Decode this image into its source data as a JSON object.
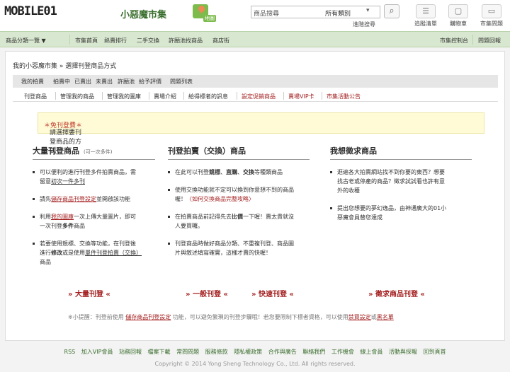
{
  "header": {
    "logo_text": "MOBILE01",
    "brand": "小惡魔市集",
    "map_badge": "地圖",
    "search": {
      "placeholder": "商品搜尋",
      "category": "所有類別",
      "advanced": "進階搜尋"
    },
    "tools": [
      {
        "label": "追蹤清單",
        "icon": "list-icon"
      },
      {
        "label": "購物車",
        "icon": "cart-icon"
      },
      {
        "label": "市集問題",
        "icon": "help-icon"
      }
    ]
  },
  "nav": {
    "items": [
      "商品分類一覽 ▼",
      "市集首頁",
      "熱賣排行",
      "二手交換",
      "許願池找商品",
      "商店街"
    ],
    "right": [
      "市集控制台",
      "問題回報"
    ]
  },
  "breadcrumb": "我的小惡魔市集 » 選擇刊登商品方式",
  "tabs": [
    "我的拍賣",
    "拍賣中",
    "已賣出",
    "未賣出",
    "許願池",
    "給予評價",
    "問題列表"
  ],
  "subtabs": [
    "刊登商品",
    "管理我的商品",
    "管理我的圖庫",
    "賣場介紹",
    "給得標者的訊息",
    "設定促銷商品",
    "賣場VIP卡",
    "市集活動公告"
  ],
  "notice": {
    "text": "請選擇要刊登商品的方式",
    "highlight": "＊免刊登費＊"
  },
  "col1": {
    "title": "大量刊登商品",
    "note": "(可一次多件)",
    "b1": "可以便利的進行刊登多件拍賣商品，需",
    "b1b": "留意",
    "b1u": "初次一件多刊",
    "b2a": "請先",
    "b2r": "儲存商品刊登設定",
    "b2b": "並開啟該功能",
    "b3a": "利用",
    "b3r": "我的圖庫",
    "b3b": "一次上傳大量圖片，即可",
    "b3c": "一次刊登",
    "b3d": "多件",
    "b3e": "商品",
    "b4a": "若要使用競標、交換等功能，在刊登後",
    "b4b": "進行",
    "b4c": "修改",
    "b4d": "或是使用",
    "b4u": "單件刊登拍賣（交換）",
    "b4e": "商品",
    "action": "» 大量刊登 «"
  },
  "col2": {
    "title": "刊登拍賣（交換）商品",
    "b1a": "在此可以刊登",
    "b1b": "競標",
    "b1c": "、",
    "b1d": "直購",
    "b1e": "、",
    "b1f": "交換",
    "b1g": "等種類商品",
    "b2a": "使用交換功能就不定可以換到你意想不到的商品",
    "b2b": "喔！",
    "b2r": "〈如何交換商品完整攻略〉",
    "b3a": "在拍賣商品前記得先去",
    "b3b": "比價",
    "b3c": "一下喔！賣太貴就沒",
    "b3d": "人要買囉。",
    "b4a": "刊登商品時做好商品分類、不重複刊登、商品圖",
    "b4b": "片與敘述填寫確實，這樣才賣的快喔！",
    "action1": "» 一般刊登 «",
    "action2": "» 快速刊登 «"
  },
  "col3": {
    "title": "我想徵求商品",
    "b1a": "逛遍各大拍賣網站找不到你要的東西？想要",
    "b1b": "找古老或停產的商品？徵求試試看也許有意",
    "b1c": "外的收穫",
    "b2a": "提出您想要的夢幻逸品，由神通廣大的01小",
    "b2b": "惡魔會員替您達成",
    "action": "» 徵求商品刊登 «"
  },
  "tip": {
    "a": "※小提醒：刊登前使用",
    "b": "儲存商品刊登設定",
    "c": "功能，可以避免繁瑣的刊登步驟哦！若您要限制下標者資格，可以使用",
    "d": "禁買設定",
    "e": "或",
    "f": "黑名單"
  },
  "footer": {
    "links": [
      "RSS",
      "加入VIP會員",
      "站務回報",
      "檔案下載",
      "常問問題",
      "服務條款",
      "隱私權政策",
      "合作與廣告",
      "聯絡我們",
      "工作機會",
      "線上會員",
      "活動與探報",
      "回到頁首"
    ],
    "copyright": "Copyright © 2014 Yong Sheng Technology Co., Ltd. All rights reserved."
  }
}
